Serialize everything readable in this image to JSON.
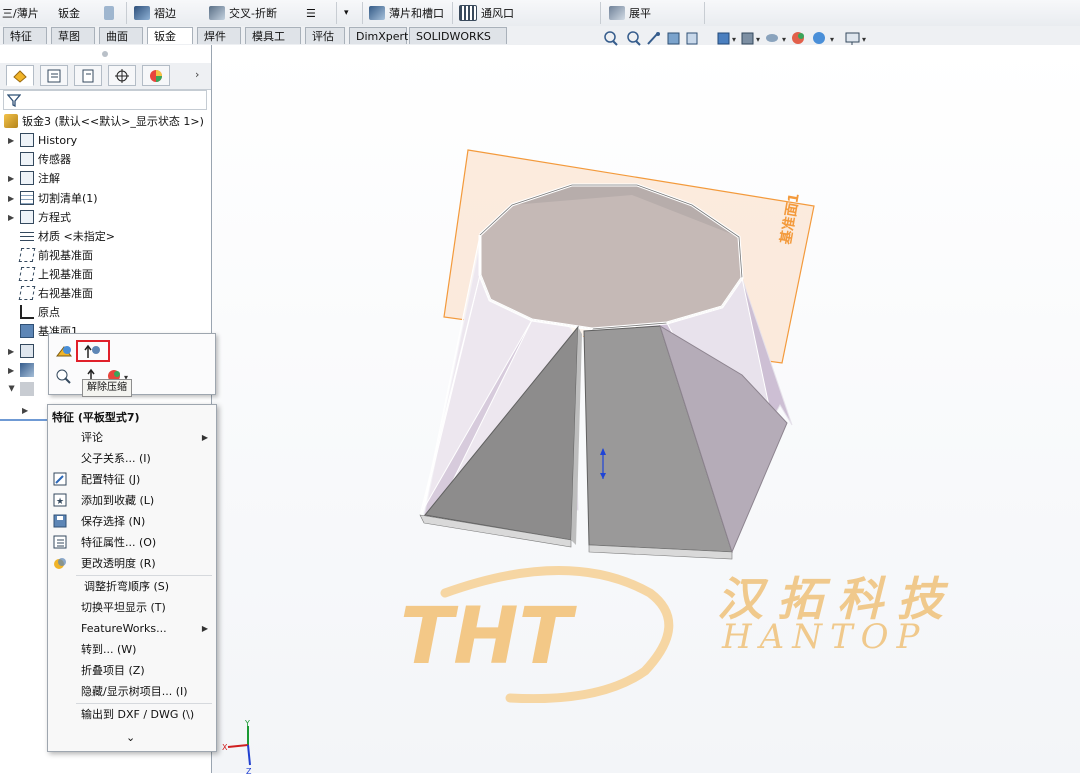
{
  "ribbon": {
    "items": [
      {
        "label": "三/薄片",
        "icon": "sheet-metal-icon"
      },
      {
        "label": "钣金",
        "icon": "sheet-metal-icon"
      },
      {
        "label": "褶边",
        "icon": "hem-icon"
      },
      {
        "label": "交叉-折断",
        "icon": "cross-break-icon"
      },
      {
        "label": "薄片和槽口",
        "icon": "tab-slot-icon"
      },
      {
        "label": "通风口",
        "icon": "vent-icon"
      },
      {
        "label": "展平",
        "icon": "flatten-icon"
      }
    ]
  },
  "tabs": [
    "特征",
    "草图",
    "曲面",
    "钣金",
    "焊件",
    "模具工具",
    "评估",
    "DimXpert",
    "SOLIDWORKS 插件"
  ],
  "active_tab": "钣金",
  "tree": {
    "root": "钣金3 (默认<<默认>_显示状态 1>)",
    "items": [
      {
        "label": "History",
        "icon": "history-icon"
      },
      {
        "label": "传感器",
        "icon": "sensor-icon"
      },
      {
        "label": "注解",
        "icon": "annotation-icon"
      },
      {
        "label": "切割清单(1)",
        "icon": "cut-list-icon"
      },
      {
        "label": "方程式",
        "icon": "equation-icon"
      },
      {
        "label": "材质 <未指定>",
        "icon": "material-icon"
      },
      {
        "label": "前视基准面",
        "icon": "plane-icon"
      },
      {
        "label": "上视基准面",
        "icon": "plane-icon"
      },
      {
        "label": "右视基准面",
        "icon": "plane-icon"
      },
      {
        "label": "原点",
        "icon": "origin-icon"
      },
      {
        "label": "基准面1",
        "icon": "plane-icon"
      }
    ]
  },
  "tooltip": "解除压缩",
  "context_menu": {
    "title": "特征 (平板型式7)",
    "items": [
      {
        "label": "评论",
        "submenu": true,
        "icon": ""
      },
      {
        "label": "父子关系... (I)",
        "submenu": false,
        "icon": ""
      },
      {
        "label": "配置特征 (J)",
        "submenu": false,
        "icon": "configure-feature-icon"
      },
      {
        "label": "添加到收藏 (L)",
        "submenu": false,
        "icon": "favorite-icon"
      },
      {
        "label": "保存选择 (N)",
        "submenu": false,
        "icon": "save-selection-icon"
      },
      {
        "label": "特征属性... (O)",
        "submenu": false,
        "icon": "feature-properties-icon"
      },
      {
        "label": "更改透明度 (R)",
        "submenu": false,
        "icon": "transparency-icon"
      },
      {
        "label": "调整折弯顺序 (S)",
        "submenu": false,
        "icon": ""
      },
      {
        "label": "切换平坦显示 (T)",
        "submenu": false,
        "icon": ""
      },
      {
        "label": "FeatureWorks...",
        "submenu": true,
        "icon": ""
      },
      {
        "label": "转到... (W)",
        "submenu": false,
        "icon": ""
      },
      {
        "label": "折叠项目 (Z)",
        "submenu": false,
        "icon": ""
      },
      {
        "label": "隐藏/显示树项目... (I)",
        "submenu": false,
        "icon": ""
      },
      {
        "label": "输出到 DXF / DWG (\\)",
        "submenu": false,
        "icon": ""
      }
    ],
    "more": "⌄"
  },
  "viewport": {
    "plane_label": "基准面1",
    "watermark_logo": "THT",
    "watermark_cn": "汉拓科技",
    "watermark_en": "HANTOP",
    "triad": {
      "x": "X",
      "y": "Y",
      "z": "Z"
    }
  },
  "colors": {
    "accent": "#1f6fd1",
    "plane": "#f39a3c",
    "highlight_box": "#e0202a"
  }
}
